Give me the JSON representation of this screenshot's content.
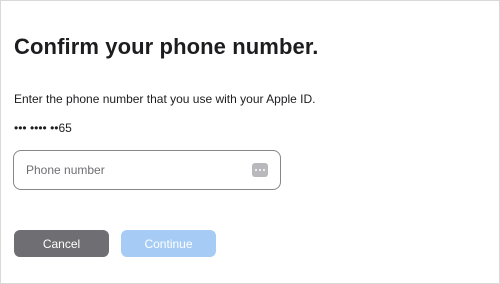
{
  "dialog": {
    "title": "Confirm your phone number.",
    "instructions": "Enter the phone number that you use with your Apple ID.",
    "masked_number": "••• •••• ••65"
  },
  "phone_field": {
    "placeholder": "Phone number",
    "value": "",
    "icon": "keypad-icon"
  },
  "buttons": {
    "cancel_label": "Cancel",
    "continue_label": "Continue",
    "continue_state": "disabled"
  },
  "colors": {
    "cancel_bg": "#6e6e73",
    "continue_bg_disabled": "#a6ccf5",
    "text": "#1d1d1f"
  }
}
